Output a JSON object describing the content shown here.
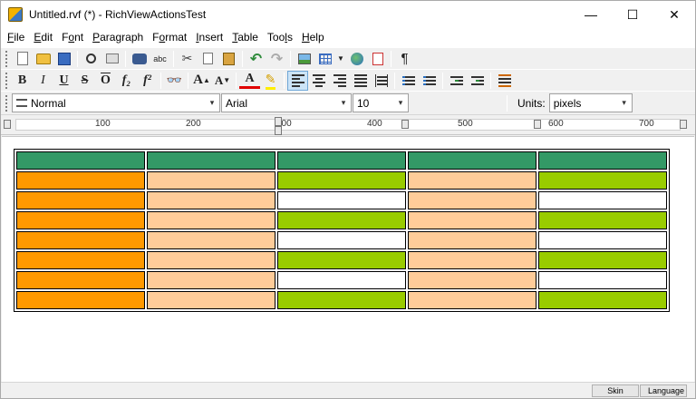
{
  "window": {
    "title": "Untitled.rvf (*) - RichViewActionsTest",
    "minimize_glyph": "—",
    "maximize_glyph": "☐",
    "close_glyph": "✕"
  },
  "menu": [
    {
      "label": "File"
    },
    {
      "label": "Edit"
    },
    {
      "label": "Font"
    },
    {
      "label": "Paragraph"
    },
    {
      "label": "Format"
    },
    {
      "label": "Insert"
    },
    {
      "label": "Table"
    },
    {
      "label": "Tools"
    },
    {
      "label": "Help"
    }
  ],
  "toolbar_main": {
    "spell_label": "abc",
    "paragraph_mark": "¶"
  },
  "toolbar_format": {
    "bold": "B",
    "italic": "I",
    "underline": "U",
    "strike": "S",
    "overline": "O",
    "subscript": "f₂",
    "superscript": "f²",
    "grow_font": "A",
    "shrink_font": "A",
    "font_color_glyph": "A"
  },
  "formatbar": {
    "style": "Normal",
    "font": "Arial",
    "size": "10",
    "units_label": "Units:",
    "units": "pixels"
  },
  "ruler": {
    "labels": [
      "100",
      "200",
      "300",
      "400",
      "500",
      "600",
      "700"
    ]
  },
  "table": {
    "rows": [
      [
        "header",
        "header",
        "header",
        "header",
        "header"
      ],
      [
        "orange",
        "peach",
        "green",
        "peach",
        "green"
      ],
      [
        "orange",
        "peach",
        "white",
        "peach",
        "white"
      ],
      [
        "orange",
        "peach",
        "green",
        "peach",
        "green"
      ],
      [
        "orange",
        "peach",
        "white",
        "peach",
        "white"
      ],
      [
        "orange",
        "peach",
        "green",
        "peach",
        "green"
      ],
      [
        "orange",
        "peach",
        "white",
        "peach",
        "white"
      ],
      [
        "orange",
        "peach",
        "green",
        "peach",
        "green"
      ]
    ],
    "colors": {
      "header": "#339966",
      "orange": "#ff9900",
      "peach": "#ffcc99",
      "green": "#99cc00",
      "white": "#ffffff"
    }
  },
  "status": {
    "skin": "Skin",
    "language": "Language"
  }
}
